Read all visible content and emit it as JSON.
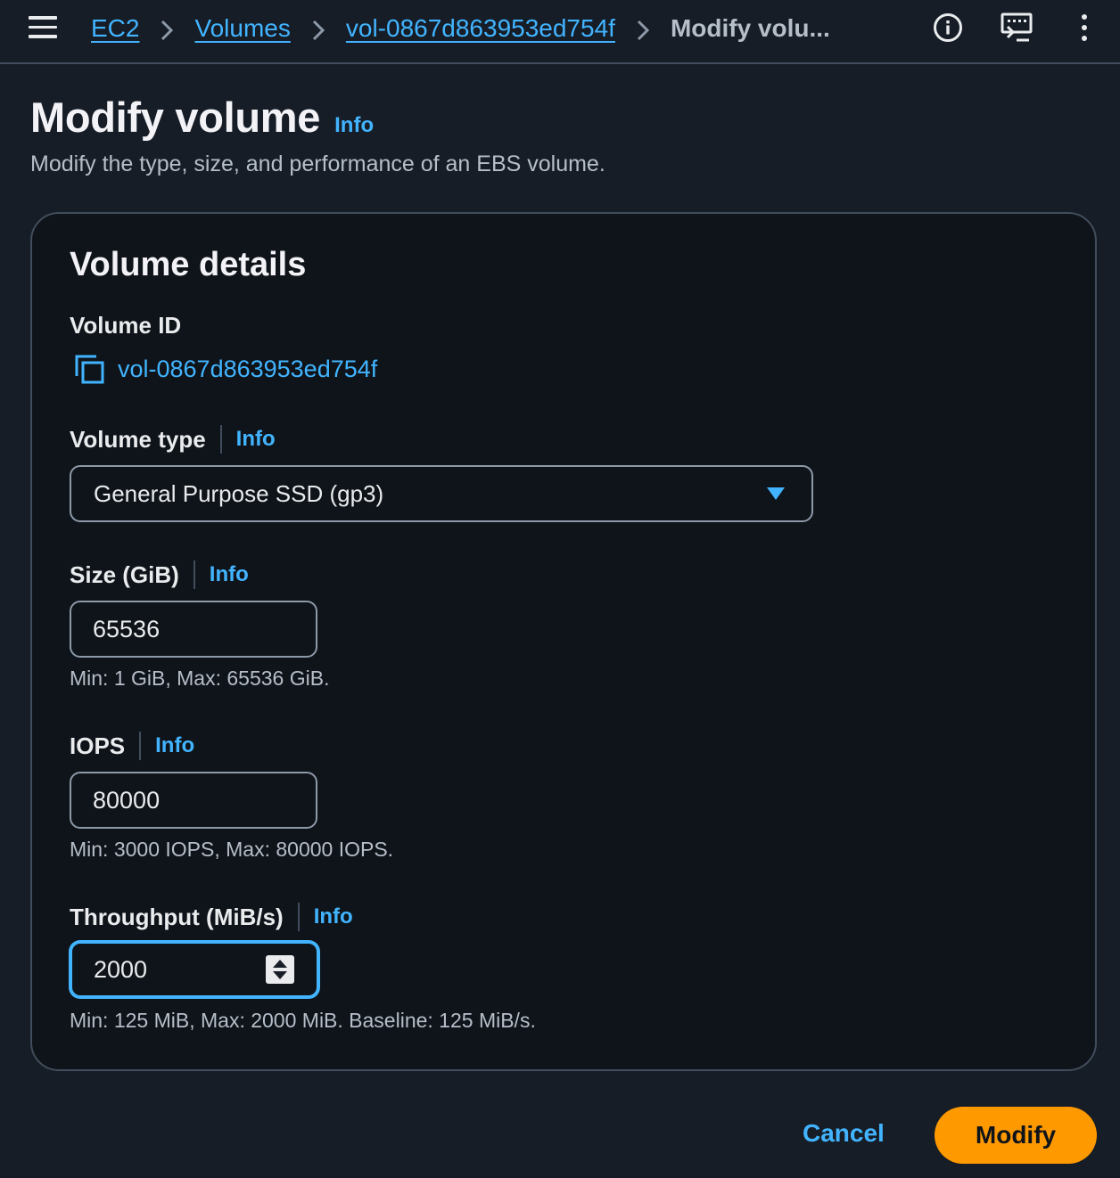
{
  "breadcrumb": {
    "items": [
      "EC2",
      "Volumes",
      "vol-0867d863953ed754f"
    ],
    "current": "Modify volu..."
  },
  "header": {
    "title": "Modify volume",
    "info": "Info",
    "description": "Modify the type, size, and performance of an EBS volume."
  },
  "panel": {
    "title": "Volume details",
    "volume_id": {
      "label": "Volume ID",
      "value": "vol-0867d863953ed754f"
    },
    "volume_type": {
      "label": "Volume type",
      "info": "Info",
      "selected": "General Purpose SSD (gp3)"
    },
    "size": {
      "label": "Size (GiB)",
      "info": "Info",
      "value": "65536",
      "hint": "Min: 1 GiB, Max: 65536 GiB."
    },
    "iops": {
      "label": "IOPS",
      "info": "Info",
      "value": "80000",
      "hint": "Min: 3000 IOPS, Max: 80000 IOPS."
    },
    "throughput": {
      "label": "Throughput (MiB/s)",
      "info": "Info",
      "value": "2000",
      "hint": "Min: 125 MiB, Max: 2000 MiB. Baseline: 125 MiB/s."
    }
  },
  "actions": {
    "cancel": "Cancel",
    "modify": "Modify"
  },
  "icons": {
    "menu": "menu-icon",
    "info": "info-circle-icon",
    "screen": "remote-screen-icon",
    "more": "more-vertical-icon",
    "copy": "copy-icon",
    "caret": "caret-down-icon"
  },
  "colors": {
    "accent": "#42b4ff",
    "primary_button": "#ff9900",
    "background": "#161d26",
    "panel": "#0f141a"
  }
}
